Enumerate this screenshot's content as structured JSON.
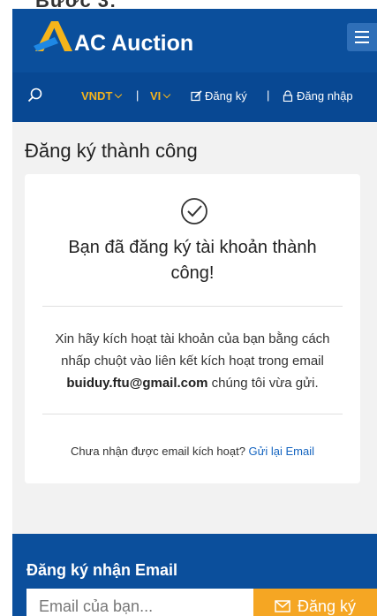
{
  "header": {
    "brand": "AC Auction",
    "logo_icon": "ac-logo-icon",
    "menu_icon": "hamburger-icon",
    "colors": {
      "primary": "#0b4f9c",
      "accent": "#f5b41b"
    }
  },
  "topbar": {
    "search_icon": "search-icon",
    "currency": "VNDT",
    "separator": "|",
    "language": "VI",
    "register_label": "Đăng ký",
    "login_label": "Đăng nhập"
  },
  "page": {
    "title": "Đăng ký thành công"
  },
  "card": {
    "check_icon": "check-circle-icon",
    "heading_line1": "Bạn đã đăng ký tài khoản thành",
    "heading_line2": "công!",
    "message_line1": "Xin hãy kích hoạt tài khoản của bạn bằng cách",
    "message_line2": "nhấp chuột vào liên kết kích hoạt trong email",
    "message_email": "buiduy.ftu@gmail.com",
    "message_tail": " chúng tôi vừa gửi.",
    "resend_prompt": "Chưa nhận được email kích hoạt? ",
    "resend_link": "Gửi lại Email"
  },
  "footer": {
    "newsletter_title": "Đăng ký nhận Email",
    "email_placeholder": "Email của bạn...",
    "subscribe_label": "Đăng ký",
    "colors": {
      "button": "#f5a623"
    }
  }
}
